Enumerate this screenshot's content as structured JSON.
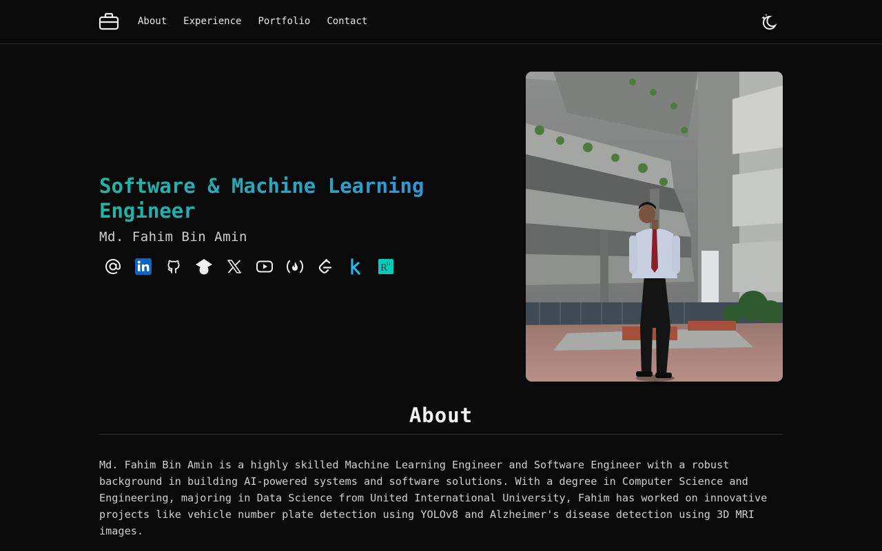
{
  "nav": {
    "logo_icon": "briefcase-icon",
    "items": [
      {
        "label": "About"
      },
      {
        "label": "Experience"
      },
      {
        "label": "Portfolio"
      },
      {
        "label": "Contact"
      }
    ],
    "theme_icon": "moon-stars-icon"
  },
  "hero": {
    "headline": "Software & Machine Learning Engineer",
    "name": "Md. Fahim Bin Amin",
    "socials": [
      {
        "icon": "email-at-icon"
      },
      {
        "icon": "linkedin-icon",
        "color": "#0a66c2"
      },
      {
        "icon": "github-icon"
      },
      {
        "icon": "google-scholar-icon"
      },
      {
        "icon": "x-twitter-icon"
      },
      {
        "icon": "youtube-icon"
      },
      {
        "icon": "freecodecamp-icon"
      },
      {
        "icon": "leetcode-icon"
      },
      {
        "icon": "kaggle-icon",
        "color": "#20beff"
      },
      {
        "icon": "researchgate-icon",
        "color": "#00ccbb"
      }
    ],
    "photo": "portrait-photo"
  },
  "about": {
    "title": "About",
    "text": "Md. Fahim Bin Amin is a highly skilled Machine Learning Engineer and Software Engineer with a robust background in building AI-powered systems and software solutions. With a degree in Computer Science and Engineering, majoring in Data Science from United International University, Fahim has worked on innovative projects like vehicle number plate detection using YOLOv8 and Alzheimer's disease detection using 3D MRI images."
  },
  "colors": {
    "background": "#0a0a0a",
    "accent_start": "#1fb5a6",
    "accent_end": "#3a8fe0"
  }
}
